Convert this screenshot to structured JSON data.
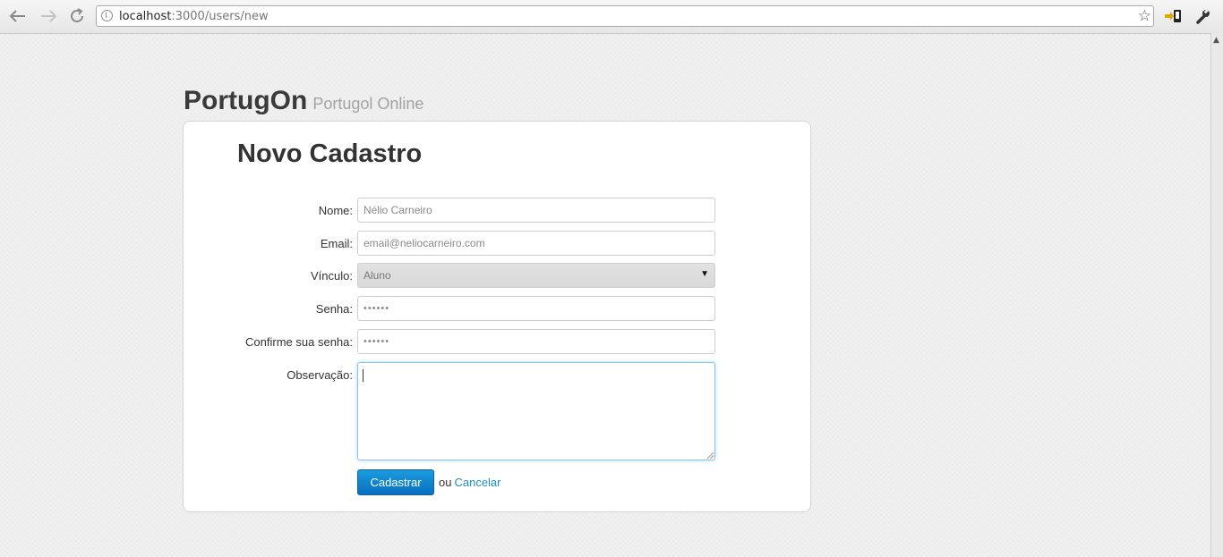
{
  "browser": {
    "url_host": "localhost",
    "url_path": ":3000/users/new"
  },
  "site": {
    "brand_name": "PortugOn",
    "brand_tagline": "Portugol Online"
  },
  "form": {
    "title": "Novo Cadastro",
    "fields": [
      {
        "label": "Nome:",
        "value": "Nélio Carneiro"
      },
      {
        "label": "Email:",
        "value": "email@neliocarneiro.com"
      },
      {
        "label": "Vínculo:",
        "value": "Aluno"
      },
      {
        "label": "Senha:",
        "value": "••••••"
      },
      {
        "label": "Confirme sua senha:",
        "value": "••••••"
      },
      {
        "label": "Observação:",
        "value": ""
      }
    ],
    "submit_label": "Cadastrar",
    "or_text": "ou",
    "cancel_label": "Cancelar"
  },
  "colors": {
    "accent": "#1a9be0",
    "link": "#1e8fc6"
  }
}
